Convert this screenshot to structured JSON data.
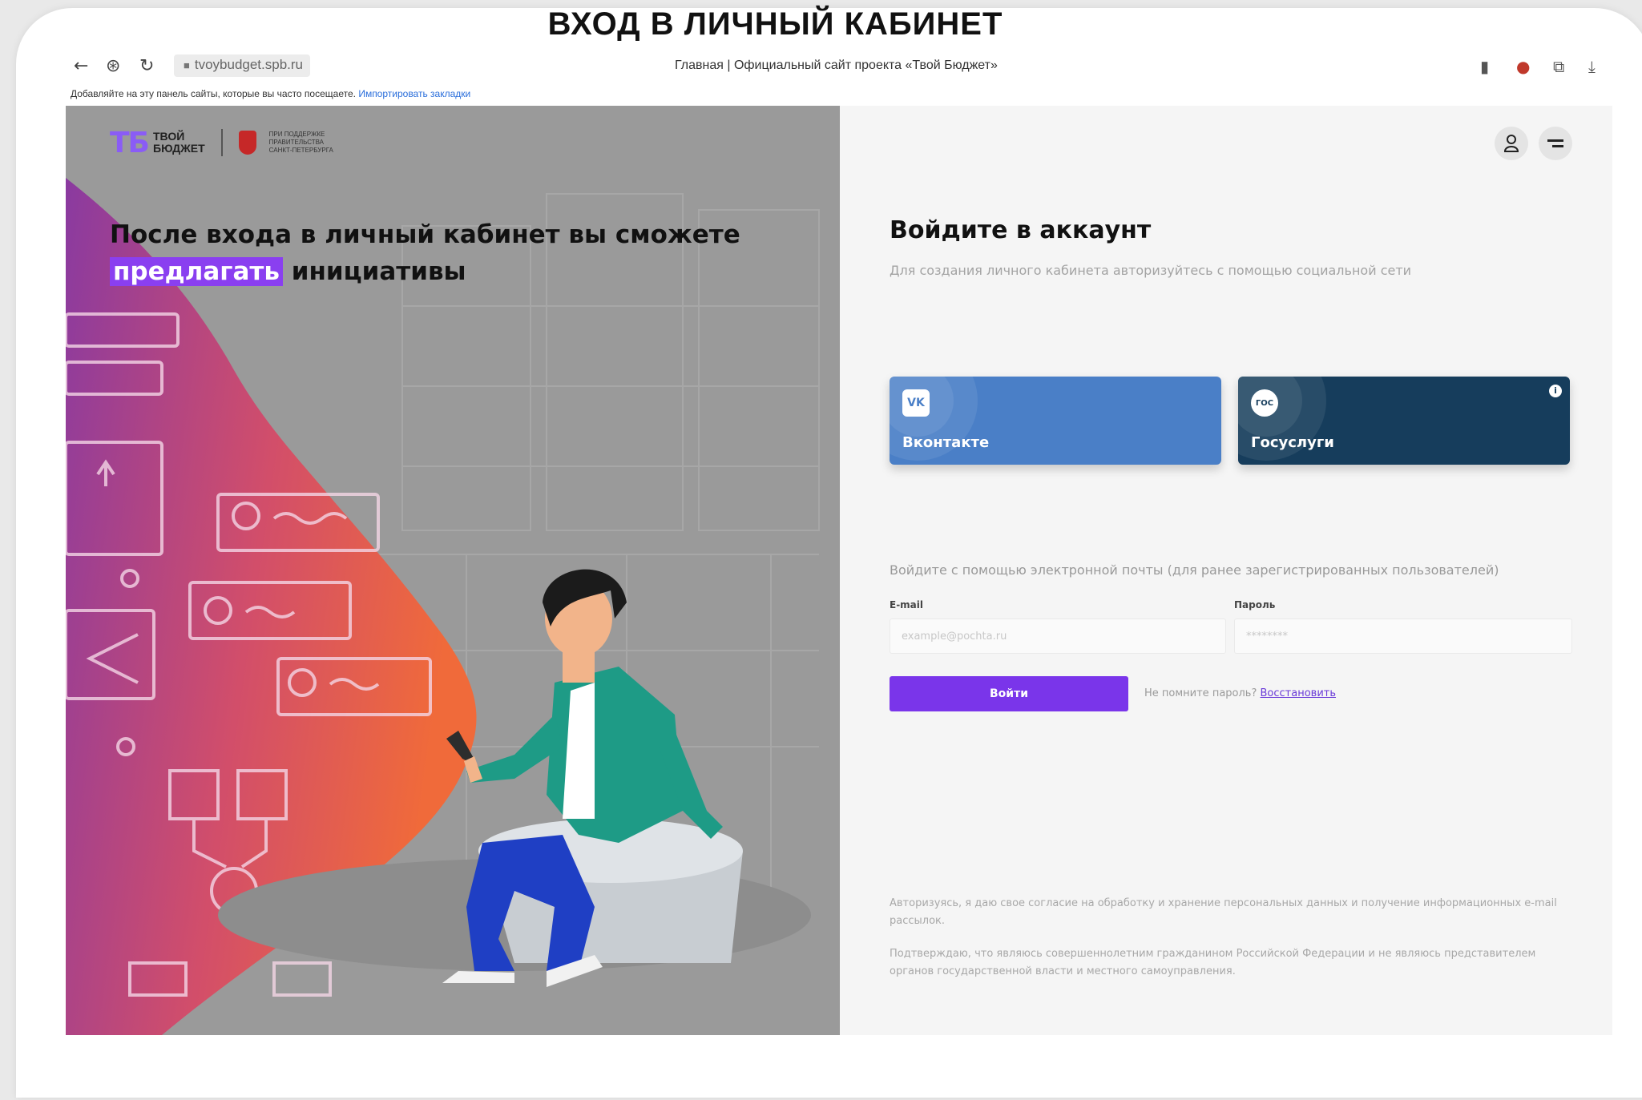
{
  "slide": {
    "title": "ВХОД В ЛИЧНЫЙ КАБИНЕТ"
  },
  "browser": {
    "url": "tvoybudget.spb.ru",
    "tab_title": "Главная | Официальный сайт проекта «Твой Бюджет»",
    "bookmarks_text": "Добавляйте на эту панель сайты, которые вы часто посещаете.",
    "bookmarks_link": "Импортировать закладки",
    "icons": [
      "back-icon",
      "shield-icon",
      "reload-icon",
      "lock-icon",
      "bookmark-icon",
      "extension-icon",
      "collections-icon",
      "download-icon"
    ]
  },
  "logo": {
    "mark": "ТБ",
    "name_line1": "ТВОЙ",
    "name_line2": "БЮДЖЕТ",
    "gov_line1": "ПРИ ПОДДЕРЖКЕ",
    "gov_line2": "ПРАВИТЕЛЬСТВА",
    "gov_line3": "САНКТ-ПЕТЕРБУРГА"
  },
  "hero": {
    "line1": "После входа в личный кабинет вы сможете",
    "highlight": "предлагать",
    "rest": " инициативы"
  },
  "login": {
    "title": "Войдите в аккаунт",
    "subtitle": "Для создания личного кабинета авторизуйтесь с помощью социальной сети",
    "vk_badge": "VK",
    "vk_label": "Вконтакте",
    "gos_badge": "ГОС",
    "gos_label": "Госуслуги",
    "gos_info": "i",
    "email_note": "Войдите с помощью электронной почты (для ранее зарегистрированных пользователей)",
    "email_label": "E-mail",
    "email_placeholder": "example@pochta.ru",
    "password_label": "Пароль",
    "password_placeholder": "********",
    "submit": "Войти",
    "forgot_text": "Не помните пароль? ",
    "forgot_link": "Восстановить",
    "legal1": "Авторизуясь, я даю свое согласие на обработку и хранение персональных данных и получение информационных e-mail рассылок.",
    "legal2": "Подтверждаю, что являюсь совершеннолетним гражданином Российской Федерации и не являюсь представителем органов государственной власти и местного самоуправления."
  },
  "colors": {
    "accent": "#7a35ea",
    "vk": "#4a7fc7",
    "gosuslugi": "#163d5c",
    "gradient_start": "#8a3aa0",
    "gradient_end": "#f06a3a"
  }
}
